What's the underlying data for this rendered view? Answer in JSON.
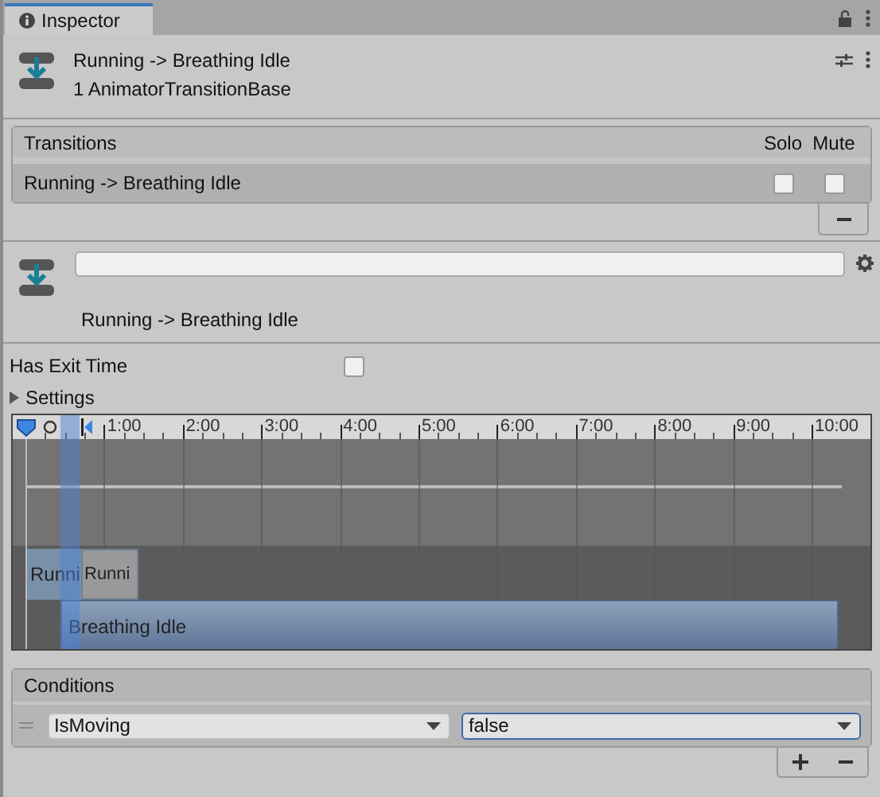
{
  "tab": {
    "title": "Inspector",
    "selected": true
  },
  "header": {
    "title": "Running -> Breathing Idle",
    "subtitle": "1 AnimatorTransitionBase"
  },
  "transitions": {
    "title": "Transitions",
    "columns": [
      "Solo",
      "Mute"
    ],
    "rows": [
      {
        "name": "Running -> Breathing Idle",
        "solo": false,
        "mute": false,
        "selected": true
      }
    ]
  },
  "transition": {
    "label": "Running -> Breathing Idle"
  },
  "has_exit_time": {
    "label": "Has Exit Time",
    "checked": false
  },
  "settings": {
    "label": "Settings",
    "expanded": false
  },
  "timeline": {
    "ruler": [
      "1:00",
      "2:00",
      "3:00",
      "4:00",
      "5:00",
      "6:00",
      "7:00",
      "8:00",
      "9:00",
      "10:00"
    ],
    "clips": [
      {
        "label": "Runni",
        "kind": "source"
      },
      {
        "label": "Runni",
        "kind": "source_next"
      },
      {
        "label": "Breathing Idle",
        "kind": "destination"
      }
    ]
  },
  "conditions": {
    "title": "Conditions",
    "rows": [
      {
        "parameter": "IsMoving",
        "value": "false",
        "focused": true
      }
    ]
  }
}
